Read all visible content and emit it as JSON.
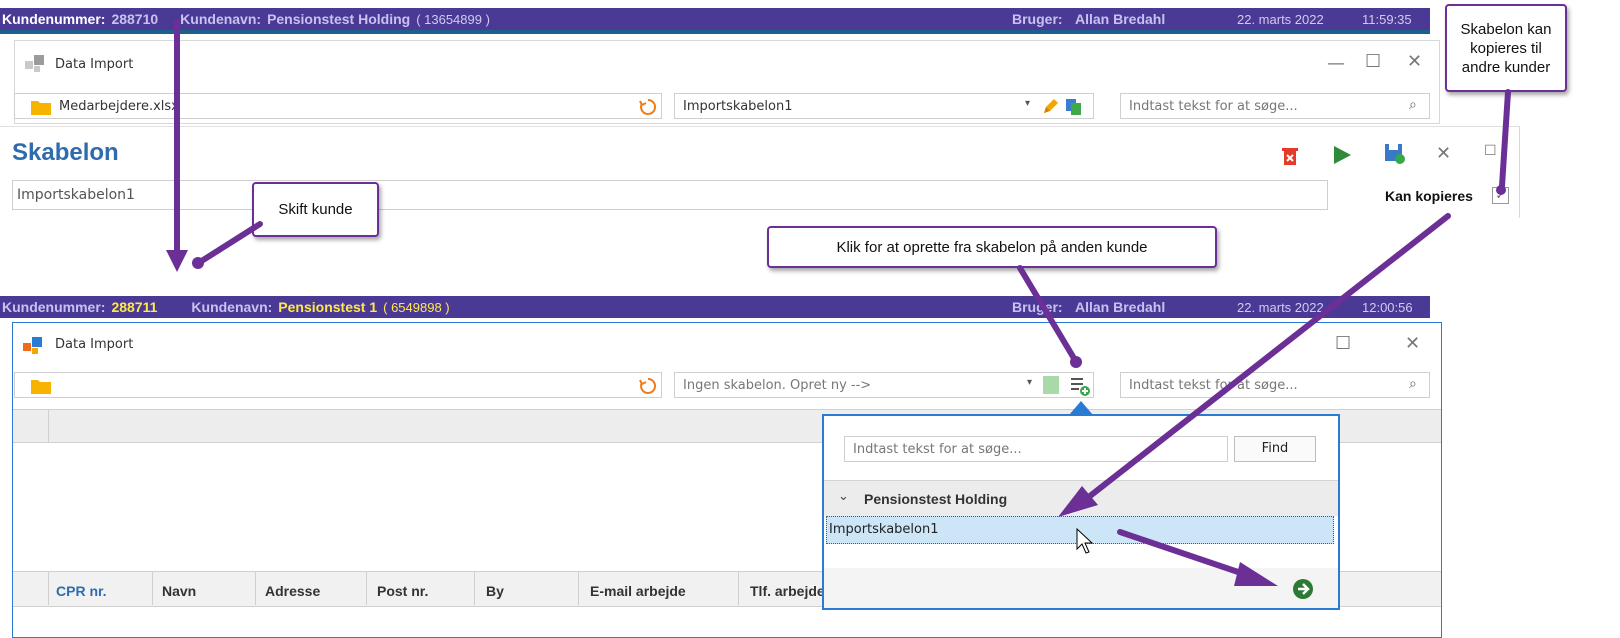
{
  "top_bar": {
    "kundenummer_label": "Kundenummer:",
    "kundenummer_value": "288710",
    "kundenavn_label": "Kundenavn:",
    "kundenavn_value": "Pensionstest Holding",
    "kundenavn_id": "( 13654899 )",
    "bruger_label": "Bruger:",
    "bruger_value": "Allan Bredahl",
    "date": "22. marts 2022",
    "time": "11:59:35"
  },
  "top_window": {
    "title": "Data Import",
    "file_value": "Medarbejdere.xlsx",
    "template_value": "Importskabelon1",
    "search_placeholder": "Indtast tekst for at søge..."
  },
  "skabelon_panel": {
    "heading": "Skabelon",
    "name_value": "Importskabelon1",
    "kan_kopieres_label": "Kan kopieres"
  },
  "callouts": {
    "skift_kunde": "Skift kunde",
    "klik_for_at": "Klik for at oprette fra skabelon på anden kunde",
    "kan_kopieres_line1": "Skabelon kan",
    "kan_kopieres_line2": "kopieres til",
    "kan_kopieres_line3": "andre kunder"
  },
  "bottom_bar": {
    "kundenummer_label": "Kundenummer:",
    "kundenummer_value": "288711",
    "kundenavn_label": "Kundenavn:",
    "kundenavn_value": "Pensionstest 1",
    "kundenavn_id": "( 6549898 )",
    "bruger_label": "Bruger:",
    "bruger_value": "Allan Bredahl",
    "date": "22. marts 2022",
    "time": "12:00:56"
  },
  "bottom_window": {
    "title": "Data Import",
    "template_placeholder": "Ingen skabelon. Opret ny -->",
    "search_placeholder": "Indtast tekst for at søge...",
    "columns": [
      "CPR nr.",
      "Navn",
      "Adresse",
      "Post nr.",
      "By",
      "E-mail arbejde",
      "Tlf. arbejde"
    ]
  },
  "popup": {
    "search_placeholder": "Indtast tekst for at søge...",
    "find_label": "Find",
    "group_label": "Pensionstest Holding",
    "item_label": "Importskabelon1"
  },
  "colors": {
    "customer_bar": "#4a3a96",
    "highlight_yellow": "#ffe84a",
    "arrow_purple": "#6b2f96",
    "heading_blue": "#2e6cae",
    "popup_border": "#2a7bd3"
  }
}
